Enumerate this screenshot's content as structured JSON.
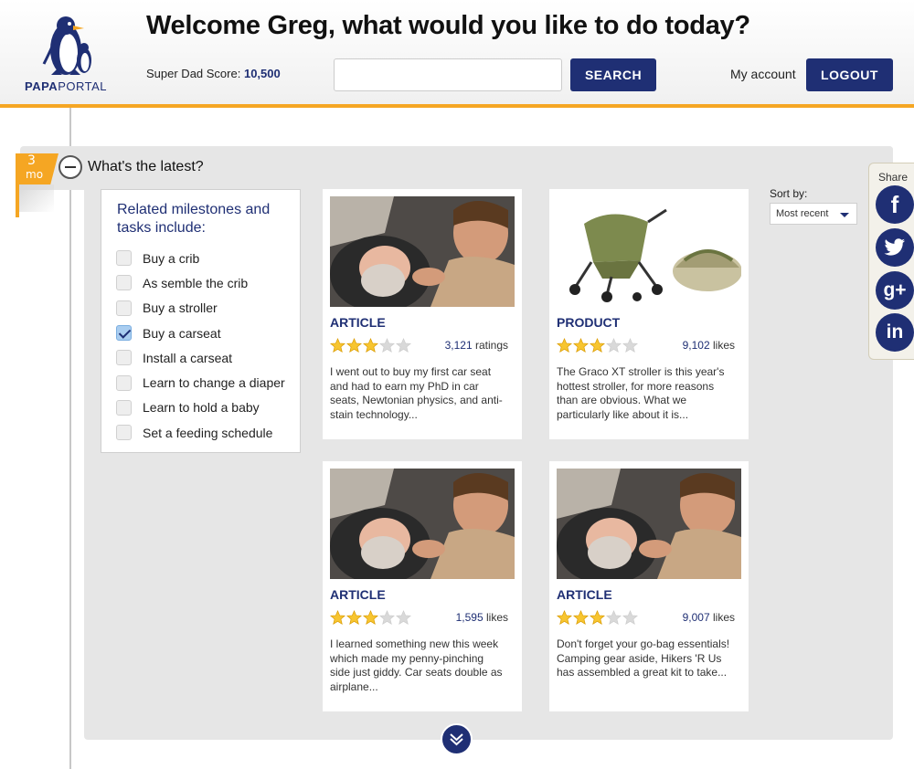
{
  "header": {
    "logo": {
      "part1": "PAPA",
      "part2": "PORTAL"
    },
    "welcome": "Welcome Greg, what would you like to do today?",
    "score_label": "Super Dad Score:",
    "score_value": "10,500",
    "search": {
      "value": "",
      "button": "SEARCH"
    },
    "my_account": "My account",
    "logout": "LOGOUT"
  },
  "timeline_flag": {
    "number": "3",
    "unit": "mo"
  },
  "section": {
    "title": "What's the latest?"
  },
  "milestones": {
    "heading": "Related milestones and tasks include:",
    "items": [
      {
        "label": "Buy a crib",
        "checked": false
      },
      {
        "label": "As semble the crib",
        "checked": false
      },
      {
        "label": "Buy a stroller",
        "checked": false
      },
      {
        "label": "Buy a carseat",
        "checked": true
      },
      {
        "label": "Install a carseat",
        "checked": false
      },
      {
        "label": "Learn to change a diaper",
        "checked": false
      },
      {
        "label": "Learn to hold a baby",
        "checked": false
      },
      {
        "label": "Set a feeding schedule",
        "checked": false
      }
    ]
  },
  "cards": [
    {
      "type": "ARTICLE",
      "rating": 3,
      "count": "3,121",
      "count_label": "ratings",
      "image": "carseat-photo",
      "desc": "I went out to buy my first car seat and had to earn my PhD in car seats, Newtonian physics, and anti-stain technology..."
    },
    {
      "type": "PRODUCT",
      "rating": 3,
      "count": "9,102",
      "count_label": "likes",
      "image": "stroller-photo",
      "desc": "The Graco XT stroller is this year's hottest stroller, for more reasons than are obvious. What we particularly like about it is..."
    },
    {
      "type": "ARTICLE",
      "rating": 3,
      "count": "1,595",
      "count_label": "likes",
      "image": "carseat-photo",
      "desc": "I learned something new this week which made my penny-pinching side just giddy. Car seats double as airplane..."
    },
    {
      "type": "ARTICLE",
      "rating": 3,
      "count": "9,007",
      "count_label": "likes",
      "image": "carseat-photo",
      "desc": "Don't forget your go-bag essentials! Camping gear aside, Hikers 'R Us has assembled a great kit to take..."
    }
  ],
  "sort": {
    "label": "Sort by:",
    "value": "Most recent"
  },
  "share": {
    "label": "Share",
    "buttons": [
      {
        "name": "facebook",
        "glyph": "f"
      },
      {
        "name": "twitter",
        "glyph": "t"
      },
      {
        "name": "googleplus",
        "glyph": "g+"
      },
      {
        "name": "linkedin",
        "glyph": "in"
      }
    ]
  },
  "colors": {
    "navy": "#1f2f74",
    "orange": "#f5a623",
    "panel": "#e6e6e6"
  }
}
